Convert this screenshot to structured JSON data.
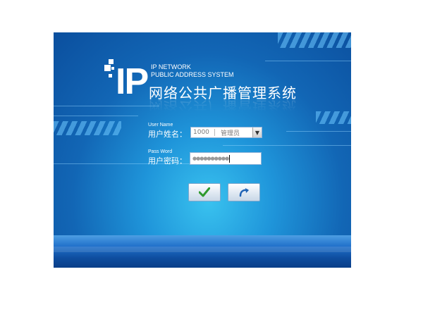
{
  "brand": {
    "logo_text": "IP",
    "line1": "IP NETWORK",
    "line2": "PUBLIC ADDRESS SYSTEM",
    "title_cn": "网络公共广播管理系统"
  },
  "username": {
    "label_en": "User Name",
    "label_cn": "用户姓名：",
    "selected_id": "1000",
    "selected_name": "管理员"
  },
  "password": {
    "label_en": "Pass Word",
    "label_cn": "用户密码：",
    "masked_value": "●●●●●●●●●●"
  },
  "buttons": {
    "ok_icon": "check-icon",
    "back_icon": "undo-arrow-icon"
  },
  "colors": {
    "bg_dark": "#0b4f9e",
    "bg_light": "#39c2ef",
    "ok_green": "#2e9a2e",
    "back_blue": "#1f63b5"
  }
}
